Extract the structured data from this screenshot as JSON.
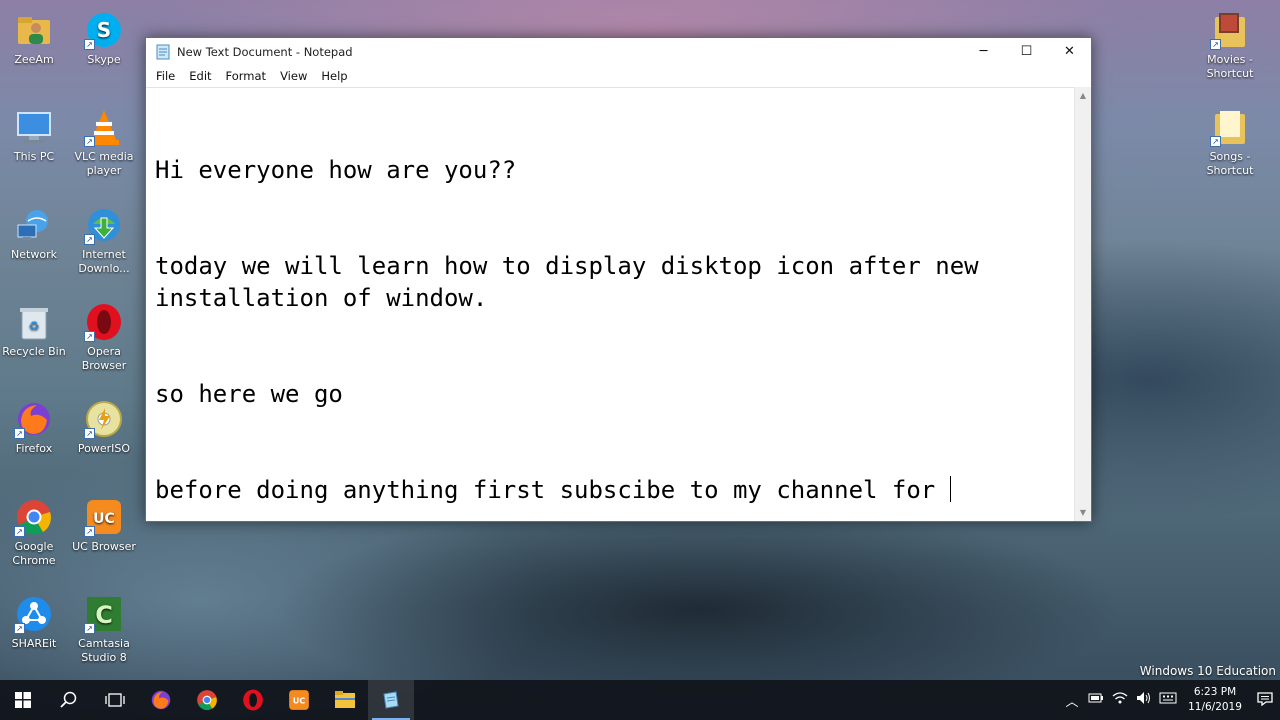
{
  "desktop": {
    "icons": [
      {
        "label": "ZeeAm",
        "icon": "user-folder-icon"
      },
      {
        "label": "Skype",
        "icon": "skype-icon"
      },
      {
        "label": "This PC",
        "icon": "computer-icon"
      },
      {
        "label": "VLC media player",
        "icon": "vlc-icon"
      },
      {
        "label": "Network",
        "icon": "network-icon"
      },
      {
        "label": "Internet Downlo...",
        "icon": "idm-icon"
      },
      {
        "label": "Recycle Bin",
        "icon": "recycle-bin-icon"
      },
      {
        "label": "Opera Browser",
        "icon": "opera-icon"
      },
      {
        "label": "Firefox",
        "icon": "firefox-icon"
      },
      {
        "label": "PowerISO",
        "icon": "poweriso-icon"
      },
      {
        "label": "Google Chrome",
        "icon": "chrome-icon"
      },
      {
        "label": "UC Browser",
        "icon": "uc-browser-icon"
      },
      {
        "label": "SHAREit",
        "icon": "shareit-icon"
      },
      {
        "label": "Camtasia Studio 8",
        "icon": "camtasia-icon"
      },
      {
        "label": "Movies - Shortcut",
        "icon": "folder-icon"
      },
      {
        "label": "Songs - Shortcut",
        "icon": "folder-icon"
      }
    ],
    "watermark": "Windows 10 Education"
  },
  "window": {
    "title": "New Text Document - Notepad",
    "menu": [
      "File",
      "Edit",
      "Format",
      "View",
      "Help"
    ],
    "controls": {
      "minimize": "─",
      "maximize": "☐",
      "close": "✕"
    },
    "lines": [
      "Hi everyone how are you??",
      "today we will learn how to display disktop icon after new installation of window.",
      "so here we go",
      "before doing anything first subscibe to my channel for "
    ]
  },
  "taskbar": {
    "apps": [
      "start-icon",
      "search-icon",
      "task-view-icon",
      "firefox-icon",
      "chrome-icon",
      "opera-icon",
      "uc-browser-icon",
      "file-explorer-icon",
      "notepad-icon"
    ],
    "clock": {
      "time": "6:23 PM",
      "date": "11/6/2019"
    }
  },
  "colors": {
    "accent": "#2b79d6",
    "taskbar": "#10141a"
  }
}
